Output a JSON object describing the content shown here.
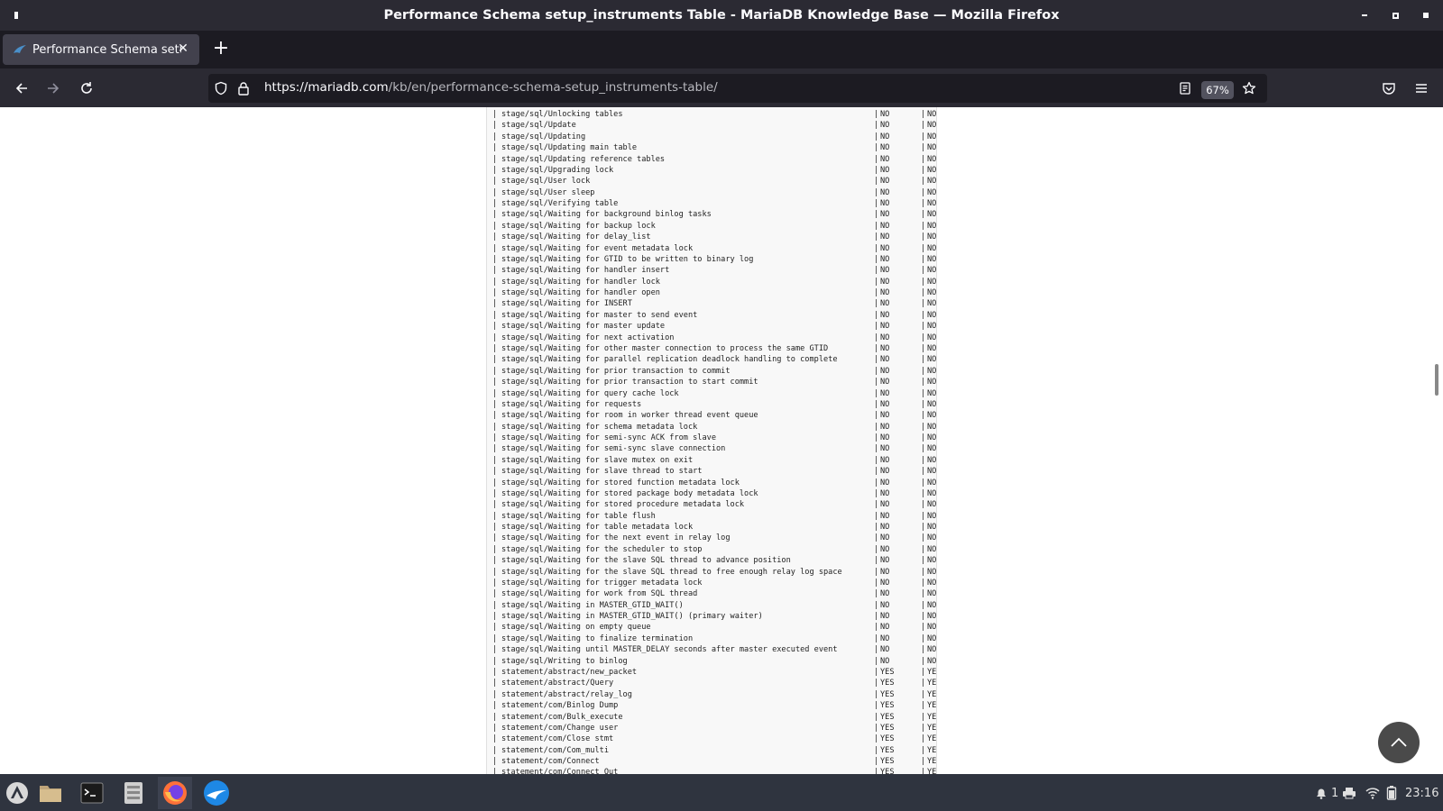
{
  "window": {
    "title": "Performance Schema setup_instruments Table - MariaDB Knowledge Base — Mozilla Firefox"
  },
  "tab": {
    "label": "Performance Schema setup_instruments Table - MariaDB Knowledge Base"
  },
  "urlbar": {
    "host": "https://mariadb.com",
    "path": "/kb/en/performance-schema-setup_instruments-table/"
  },
  "zoom": "67%",
  "rows": [
    {
      "name": "stage/sql/Unlocking tables",
      "enabled": "NO",
      "timed": "NO"
    },
    {
      "name": "stage/sql/Update",
      "enabled": "NO",
      "timed": "NO"
    },
    {
      "name": "stage/sql/Updating",
      "enabled": "NO",
      "timed": "NO"
    },
    {
      "name": "stage/sql/Updating main table",
      "enabled": "NO",
      "timed": "NO"
    },
    {
      "name": "stage/sql/Updating reference tables",
      "enabled": "NO",
      "timed": "NO"
    },
    {
      "name": "stage/sql/Upgrading lock",
      "enabled": "NO",
      "timed": "NO"
    },
    {
      "name": "stage/sql/User lock",
      "enabled": "NO",
      "timed": "NO"
    },
    {
      "name": "stage/sql/User sleep",
      "enabled": "NO",
      "timed": "NO"
    },
    {
      "name": "stage/sql/Verifying table",
      "enabled": "NO",
      "timed": "NO"
    },
    {
      "name": "stage/sql/Waiting for background binlog tasks",
      "enabled": "NO",
      "timed": "NO"
    },
    {
      "name": "stage/sql/Waiting for backup lock",
      "enabled": "NO",
      "timed": "NO"
    },
    {
      "name": "stage/sql/Waiting for delay_list",
      "enabled": "NO",
      "timed": "NO"
    },
    {
      "name": "stage/sql/Waiting for event metadata lock",
      "enabled": "NO",
      "timed": "NO"
    },
    {
      "name": "stage/sql/Waiting for GTID to be written to binary log",
      "enabled": "NO",
      "timed": "NO"
    },
    {
      "name": "stage/sql/Waiting for handler insert",
      "enabled": "NO",
      "timed": "NO"
    },
    {
      "name": "stage/sql/Waiting for handler lock",
      "enabled": "NO",
      "timed": "NO"
    },
    {
      "name": "stage/sql/Waiting for handler open",
      "enabled": "NO",
      "timed": "NO"
    },
    {
      "name": "stage/sql/Waiting for INSERT",
      "enabled": "NO",
      "timed": "NO"
    },
    {
      "name": "stage/sql/Waiting for master to send event",
      "enabled": "NO",
      "timed": "NO"
    },
    {
      "name": "stage/sql/Waiting for master update",
      "enabled": "NO",
      "timed": "NO"
    },
    {
      "name": "stage/sql/Waiting for next activation",
      "enabled": "NO",
      "timed": "NO"
    },
    {
      "name": "stage/sql/Waiting for other master connection to process the same GTID",
      "enabled": "NO",
      "timed": "NO"
    },
    {
      "name": "stage/sql/Waiting for parallel replication deadlock handling to complete",
      "enabled": "NO",
      "timed": "NO"
    },
    {
      "name": "stage/sql/Waiting for prior transaction to commit",
      "enabled": "NO",
      "timed": "NO"
    },
    {
      "name": "stage/sql/Waiting for prior transaction to start commit",
      "enabled": "NO",
      "timed": "NO"
    },
    {
      "name": "stage/sql/Waiting for query cache lock",
      "enabled": "NO",
      "timed": "NO"
    },
    {
      "name": "stage/sql/Waiting for requests",
      "enabled": "NO",
      "timed": "NO"
    },
    {
      "name": "stage/sql/Waiting for room in worker thread event queue",
      "enabled": "NO",
      "timed": "NO"
    },
    {
      "name": "stage/sql/Waiting for schema metadata lock",
      "enabled": "NO",
      "timed": "NO"
    },
    {
      "name": "stage/sql/Waiting for semi-sync ACK from slave",
      "enabled": "NO",
      "timed": "NO"
    },
    {
      "name": "stage/sql/Waiting for semi-sync slave connection",
      "enabled": "NO",
      "timed": "NO"
    },
    {
      "name": "stage/sql/Waiting for slave mutex on exit",
      "enabled": "NO",
      "timed": "NO"
    },
    {
      "name": "stage/sql/Waiting for slave thread to start",
      "enabled": "NO",
      "timed": "NO"
    },
    {
      "name": "stage/sql/Waiting for stored function metadata lock",
      "enabled": "NO",
      "timed": "NO"
    },
    {
      "name": "stage/sql/Waiting for stored package body metadata lock",
      "enabled": "NO",
      "timed": "NO"
    },
    {
      "name": "stage/sql/Waiting for stored procedure metadata lock",
      "enabled": "NO",
      "timed": "NO"
    },
    {
      "name": "stage/sql/Waiting for table flush",
      "enabled": "NO",
      "timed": "NO"
    },
    {
      "name": "stage/sql/Waiting for table metadata lock",
      "enabled": "NO",
      "timed": "NO"
    },
    {
      "name": "stage/sql/Waiting for the next event in relay log",
      "enabled": "NO",
      "timed": "NO"
    },
    {
      "name": "stage/sql/Waiting for the scheduler to stop",
      "enabled": "NO",
      "timed": "NO"
    },
    {
      "name": "stage/sql/Waiting for the slave SQL thread to advance position",
      "enabled": "NO",
      "timed": "NO"
    },
    {
      "name": "stage/sql/Waiting for the slave SQL thread to free enough relay log space",
      "enabled": "NO",
      "timed": "NO"
    },
    {
      "name": "stage/sql/Waiting for trigger metadata lock",
      "enabled": "NO",
      "timed": "NO"
    },
    {
      "name": "stage/sql/Waiting for work from SQL thread",
      "enabled": "NO",
      "timed": "NO"
    },
    {
      "name": "stage/sql/Waiting in MASTER_GTID_WAIT()",
      "enabled": "NO",
      "timed": "NO"
    },
    {
      "name": "stage/sql/Waiting in MASTER_GTID_WAIT() (primary waiter)",
      "enabled": "NO",
      "timed": "NO"
    },
    {
      "name": "stage/sql/Waiting on empty queue",
      "enabled": "NO",
      "timed": "NO"
    },
    {
      "name": "stage/sql/Waiting to finalize termination",
      "enabled": "NO",
      "timed": "NO"
    },
    {
      "name": "stage/sql/Waiting until MASTER_DELAY seconds after master executed event",
      "enabled": "NO",
      "timed": "NO"
    },
    {
      "name": "stage/sql/Writing to binlog",
      "enabled": "NO",
      "timed": "NO"
    },
    {
      "name": "statement/abstract/new_packet",
      "enabled": "YES",
      "timed": "YE"
    },
    {
      "name": "statement/abstract/Query",
      "enabled": "YES",
      "timed": "YE"
    },
    {
      "name": "statement/abstract/relay_log",
      "enabled": "YES",
      "timed": "YE"
    },
    {
      "name": "statement/com/Binlog Dump",
      "enabled": "YES",
      "timed": "YE"
    },
    {
      "name": "statement/com/Bulk_execute",
      "enabled": "YES",
      "timed": "YE"
    },
    {
      "name": "statement/com/Change user",
      "enabled": "YES",
      "timed": "YE"
    },
    {
      "name": "statement/com/Close stmt",
      "enabled": "YES",
      "timed": "YE"
    },
    {
      "name": "statement/com/Com_multi",
      "enabled": "YES",
      "timed": "YE"
    },
    {
      "name": "statement/com/Connect",
      "enabled": "YES",
      "timed": "YE"
    },
    {
      "name": "statement/com/Connect Out",
      "enabled": "YES",
      "timed": "YE"
    }
  ],
  "taskbar": {
    "notifications_count": "1",
    "clock": "23:16"
  },
  "icons": {
    "reader": "reader-view-icon",
    "bookmark": "bookmark-star-icon",
    "pocket": "pocket-icon",
    "menu": "hamburger-menu-icon"
  },
  "colors": {
    "titlebar": "#2b2a33",
    "tabstrip": "#1c1b22",
    "taskbar": "#2f343f",
    "code_bg": "#f8f8f8"
  }
}
